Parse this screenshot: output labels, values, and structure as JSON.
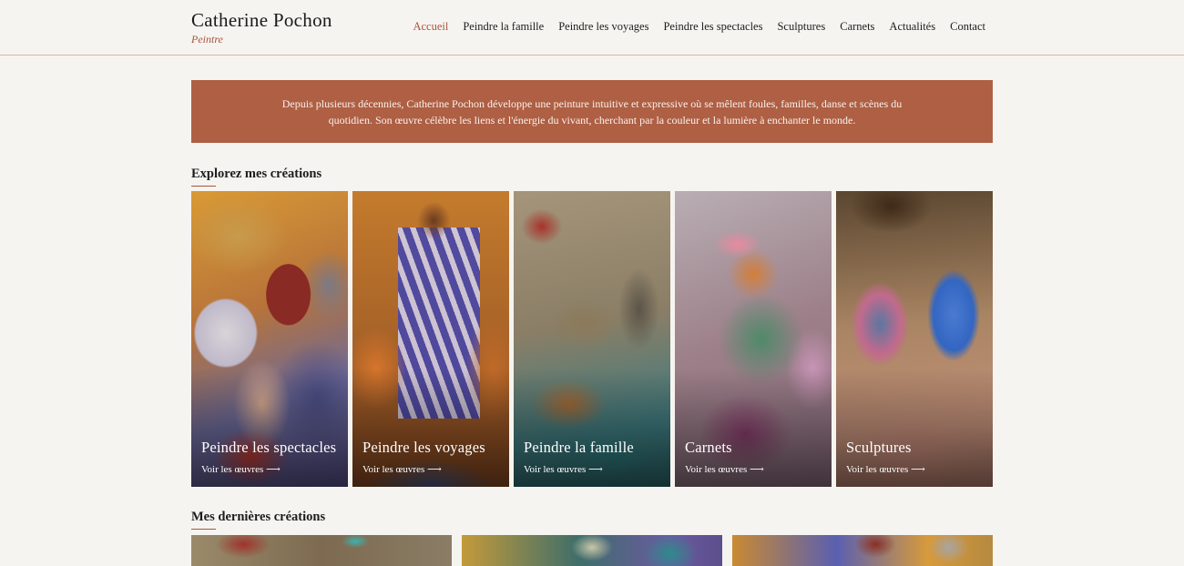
{
  "brand": {
    "name": "Catherine Pochon",
    "subtitle": "Peintre"
  },
  "nav": {
    "items": [
      {
        "label": "Accueil",
        "active": true
      },
      {
        "label": "Peindre la famille"
      },
      {
        "label": "Peindre les voyages"
      },
      {
        "label": "Peindre les spectacles"
      },
      {
        "label": "Sculptures"
      },
      {
        "label": "Carnets"
      },
      {
        "label": "Actualités"
      },
      {
        "label": "Contact"
      }
    ]
  },
  "intro": {
    "text": "Depuis plusieurs décennies, Catherine Pochon développe une peinture intuitive et expressive où se mêlent foules, familles, danse et scènes du quotidien. Son œuvre célèbre les liens et l'énergie du vivant, cherchant par la couleur et la lumière à enchanter le monde."
  },
  "explore": {
    "title": "Explorez mes créations",
    "cards": [
      {
        "title": "Peindre les spectacles",
        "link": "Voir les œuvres ⟶"
      },
      {
        "title": "Peindre les voyages",
        "link": "Voir les œuvres ⟶"
      },
      {
        "title": "Peindre la famille",
        "link": "Voir les œuvres ⟶"
      },
      {
        "title": "Carnets",
        "link": "Voir les œuvres ⟶"
      },
      {
        "title": "Sculptures",
        "link": "Voir les œuvres ⟶"
      }
    ]
  },
  "latest": {
    "title": "Mes dernières créations"
  },
  "colors": {
    "accent": "#a8563b",
    "banner": "#ae5f44",
    "background": "#f6f4f0"
  }
}
